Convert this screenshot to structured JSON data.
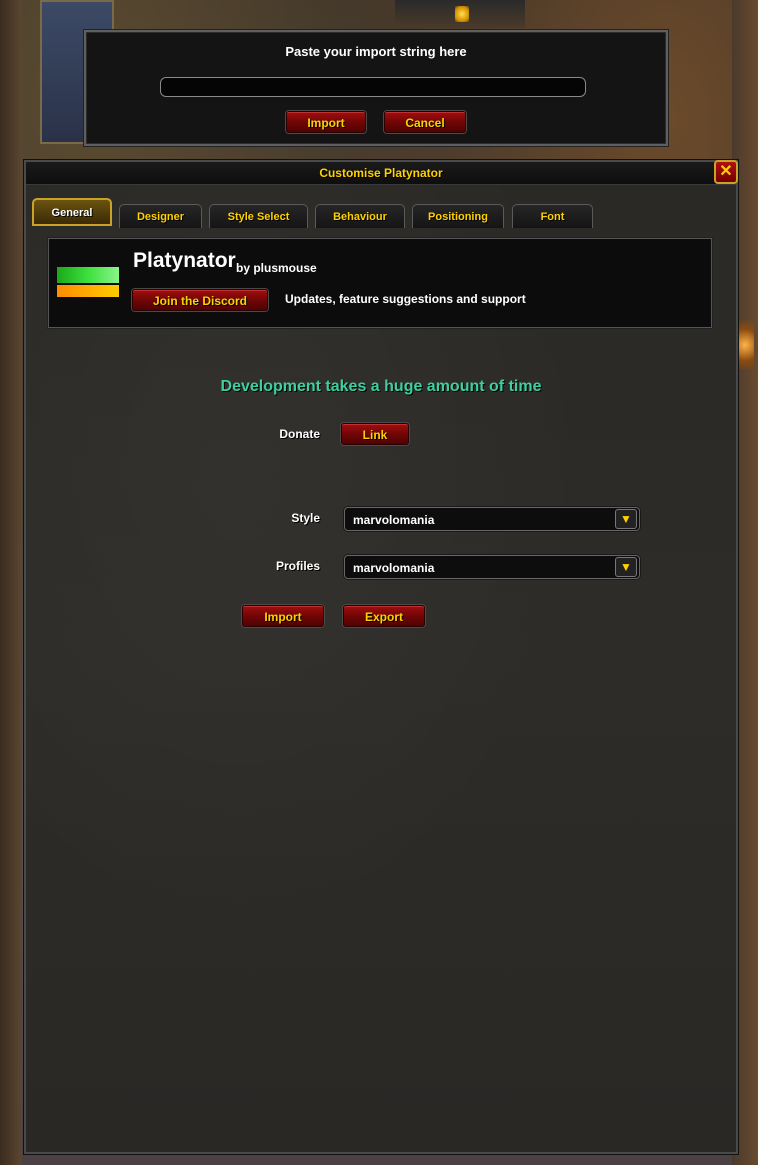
{
  "import_dialog": {
    "title": "Paste your import string here",
    "input_value": "",
    "import_label": "Import",
    "cancel_label": "Cancel"
  },
  "panel": {
    "title": "Customise Platynator",
    "close_icon": "close-icon",
    "tabs": [
      {
        "label": "General",
        "active": true
      },
      {
        "label": "Designer"
      },
      {
        "label": "Style Select"
      },
      {
        "label": "Behaviour"
      },
      {
        "label": "Positioning"
      },
      {
        "label": "Font"
      }
    ]
  },
  "header": {
    "name": "Platynator",
    "author": "by plusmouse",
    "discord_label": "Join the Discord",
    "support_text": "Updates, feature suggestions and support"
  },
  "general": {
    "promo": "Development takes a huge amount of time",
    "donate_label": "Donate",
    "link_label": "Link",
    "style_label": "Style",
    "style_value": "marvolomania",
    "profiles_label": "Profiles",
    "profiles_value": "marvolomania",
    "import_label": "Import",
    "export_label": "Export"
  },
  "colors": {
    "accent_gold": "#ffd100",
    "promo_teal": "#3ecfa0",
    "button_red": "#8a0a0a"
  }
}
